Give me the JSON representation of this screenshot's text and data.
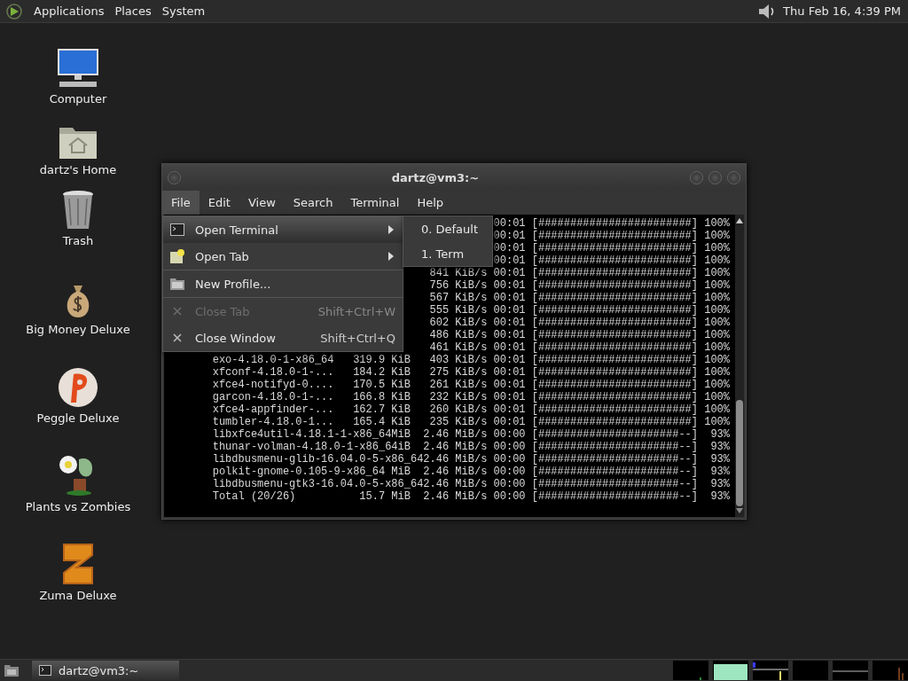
{
  "top_panel": {
    "menus": [
      "Applications",
      "Places",
      "System"
    ],
    "clock": "Thu Feb 16,  4:39 PM"
  },
  "desktop_icons": [
    {
      "label": "Computer",
      "kind": "computer"
    },
    {
      "label": "dartz's Home",
      "kind": "home"
    },
    {
      "label": "Trash",
      "kind": "trash"
    },
    {
      "label": "Big Money Deluxe",
      "kind": "moneybag"
    },
    {
      "label": "Peggle Deluxe",
      "kind": "peggle"
    },
    {
      "label": "Plants vs Zombies",
      "kind": "plant"
    },
    {
      "label": "Zuma Deluxe",
      "kind": "zuma"
    }
  ],
  "window": {
    "title": "dartz@vm3:~",
    "menubar": [
      {
        "label": "File",
        "selected": true
      },
      {
        "label": "Edit",
        "selected": false
      },
      {
        "label": "View",
        "selected": false
      },
      {
        "label": "Search",
        "selected": false
      },
      {
        "label": "Terminal",
        "selected": false
      },
      {
        "label": "Help",
        "selected": false
      }
    ],
    "terminal_lines": [
      "00:01 [########################] 100%",
      "00:01 [########################] 100%",
      "00:01 [########################] 100%",
      "00:01 [########################] 100%",
      "841 KiB/s 00:01 [########################] 100%",
      "756 KiB/s 00:01 [########################] 100%",
      "567 KiB/s 00:01 [########################] 100%",
      "555 KiB/s 00:01 [########################] 100%",
      "602 KiB/s 00:01 [########################] 100%",
      "486 KiB/s 00:01 [########################] 100%",
      "461 KiB/s 00:01 [########################] 100%",
      "exo-4.18.0-1-x86_64   319.9 KiB   403 KiB/s 00:01 [########################] 100%",
      "xfconf-4.18.0-1-...   184.2 KiB   275 KiB/s 00:01 [########################] 100%",
      "xfce4-notifyd-0....   170.5 KiB   261 KiB/s 00:01 [########################] 100%",
      "garcon-4.18.0-1-...   166.8 KiB   232 KiB/s 00:01 [########################] 100%",
      "xfce4-appfinder-...   162.7 KiB   260 KiB/s 00:01 [########################] 100%",
      "tumbler-4.18.0-1...   165.4 KiB   235 KiB/s 00:01 [########################] 100%",
      "libxfce4util-4.18.1-1-x86_64MiB  2.46 MiB/s 00:00 [######################--]  93%",
      "thunar-volman-4.18.0-1-x86_64iB  2.46 MiB/s 00:00 [######################--]  93%",
      "libdbusmenu-glib-16.04.0-5-x86_642.46 MiB/s 00:00 [######################--]  93%",
      "polkit-gnome-0.105-9-x86_64 MiB  2.46 MiB/s 00:00 [######################--]  93%",
      "libdbusmenu-gtk3-16.04.0-5-x86_642.46 MiB/s 00:00 [######################--]  93%",
      "Total (20/26)          15.7 MiB  2.46 MiB/s 00:00 [######################--]  93%"
    ],
    "file_menu": [
      {
        "kind": "terminal",
        "label": "Open Terminal",
        "submenu": true,
        "selected": true,
        "disabled": false
      },
      {
        "kind": "tab",
        "label": "Open Tab",
        "submenu": true,
        "selected": false,
        "disabled": false
      },
      {
        "kind": "separator"
      },
      {
        "kind": "profile",
        "label": "New Profile...",
        "submenu": false,
        "selected": false,
        "disabled": false
      },
      {
        "kind": "separator"
      },
      {
        "kind": "close",
        "label": "Close Tab",
        "shortcut": "Shift+Ctrl+W",
        "submenu": false,
        "selected": false,
        "disabled": true
      },
      {
        "kind": "close",
        "label": "Close Window",
        "shortcut": "Shift+Ctrl+Q",
        "submenu": false,
        "selected": false,
        "disabled": false
      }
    ],
    "submenu": [
      {
        "label": "0. Default"
      },
      {
        "label": "1. Term"
      }
    ]
  },
  "taskbar": {
    "tasks": [
      {
        "label": "dartz@vm3:~"
      }
    ]
  }
}
